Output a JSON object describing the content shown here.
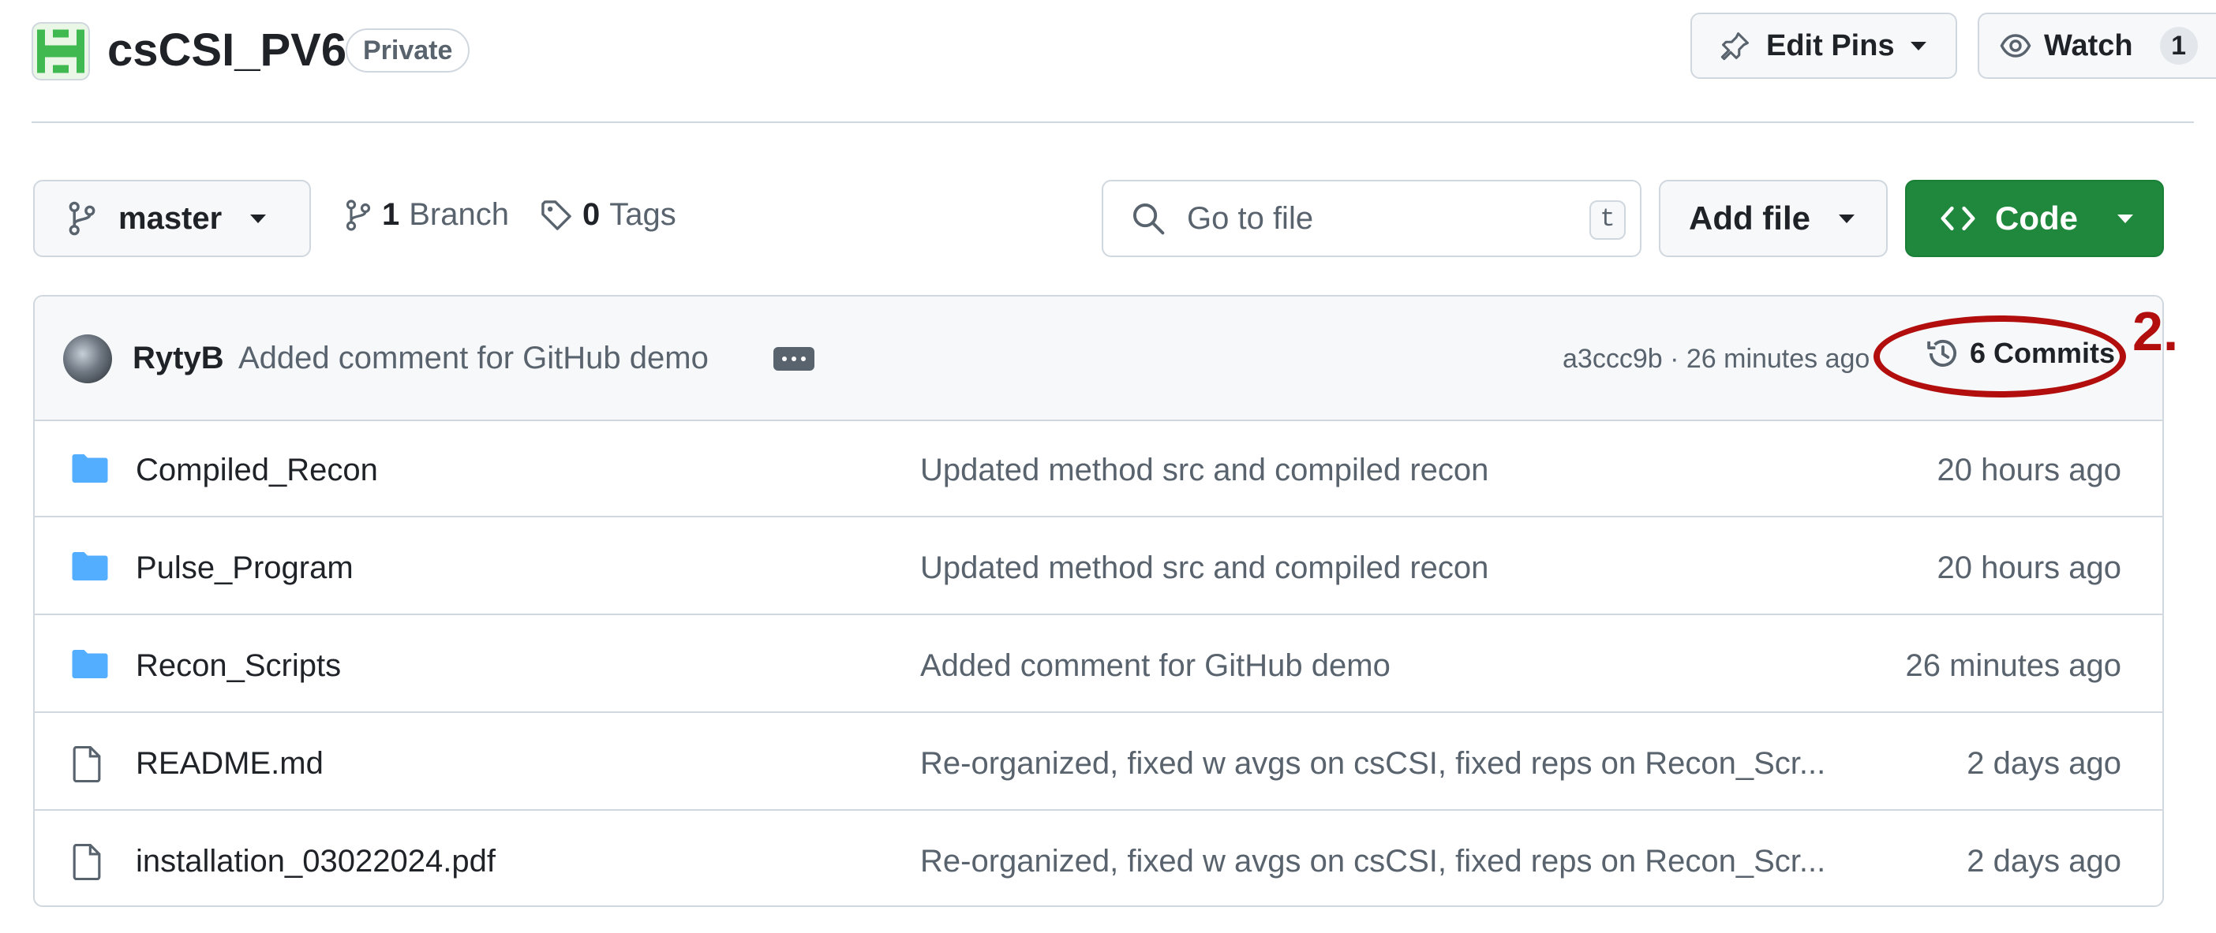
{
  "repo": {
    "name": "csCSI_PV6",
    "visibility": "Private",
    "avatar_icon": "identicon-green"
  },
  "header_actions": {
    "edit_pins": "Edit Pins",
    "watch": "Watch",
    "watch_count": "1"
  },
  "toolbar": {
    "branch": "master",
    "branches_count": "1",
    "branches_label": "Branch",
    "tags_count": "0",
    "tags_label": "Tags",
    "search_placeholder": "Go to file",
    "search_shortcut": "t",
    "add_file": "Add file",
    "code": "Code"
  },
  "latest_commit": {
    "author": "RytyB",
    "message": "Added comment for GitHub demo",
    "hash_time": "a3ccc9b · 26 minutes ago",
    "commits_label": "6 Commits"
  },
  "annotation": {
    "label": "2.",
    "color": "#b30e0e"
  },
  "files": [
    {
      "type": "folder",
      "name": "Compiled_Recon",
      "commit": "Updated method src and compiled recon",
      "date": "20 hours ago"
    },
    {
      "type": "folder",
      "name": "Pulse_Program",
      "commit": "Updated method src and compiled recon",
      "date": "20 hours ago"
    },
    {
      "type": "folder",
      "name": "Recon_Scripts",
      "commit": "Added comment for GitHub demo",
      "date": "26 minutes ago"
    },
    {
      "type": "file",
      "name": "README.md",
      "commit": "Re-organized, fixed w avgs on csCSI, fixed reps on Recon_Scr...",
      "date": "2 days ago"
    },
    {
      "type": "file",
      "name": "installation_03022024.pdf",
      "commit": "Re-organized, fixed w avgs on csCSI, fixed reps on Recon_Scr...",
      "date": "2 days ago"
    }
  ],
  "colors": {
    "accent_green": "#1f883d",
    "folder_blue": "#54aeff",
    "muted_text": "#59636e",
    "border": "#d0d7de"
  }
}
